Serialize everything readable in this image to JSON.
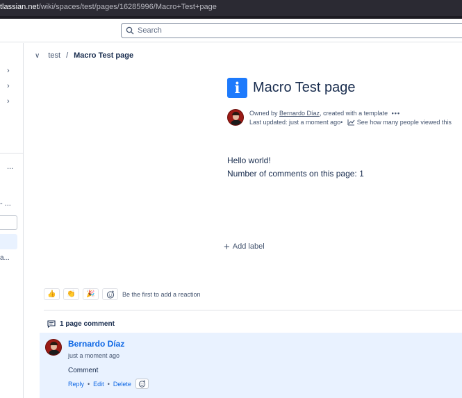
{
  "browser": {
    "url_host": "tlassian.net",
    "url_path": "/wiki/spaces/test/pages/16285996/Macro+Test+page"
  },
  "search": {
    "placeholder": "Search"
  },
  "sidebar": {
    "ellipsis_1": "...",
    "ellipsis_2": "...",
    "truncated_item": "a..."
  },
  "breadcrumb": {
    "space": "test",
    "separator": "/",
    "current": "Macro Test page"
  },
  "page": {
    "title": "Macro Test page",
    "title_icon": "info-icon",
    "owned_by_prefix": "Owned by ",
    "owner": "Bernardo Díaz",
    "owned_by_suffix": ", created with a template",
    "more_dots": "•••",
    "last_updated": "Last updated: just a moment ago",
    "bullet": "•",
    "views_link": "See how many people viewed this",
    "body_line_1": "Hello world!",
    "body_line_2": "Number of comments on this page: 1",
    "add_label": "Add label"
  },
  "reactions": {
    "emojis": [
      "👍",
      "👏",
      "🎉"
    ],
    "prompt": "Be the first to add a reaction"
  },
  "comments": {
    "count_label": "1 page comment",
    "items": [
      {
        "author": "Bernardo Díaz",
        "time": "just a moment ago",
        "body": "Comment",
        "reply": "Reply",
        "edit": "Edit",
        "delete": "Delete"
      }
    ]
  },
  "colors": {
    "accent": "#0c66e4",
    "info_icon": "#1d7afc",
    "comment_bg": "#e9f2ff"
  }
}
